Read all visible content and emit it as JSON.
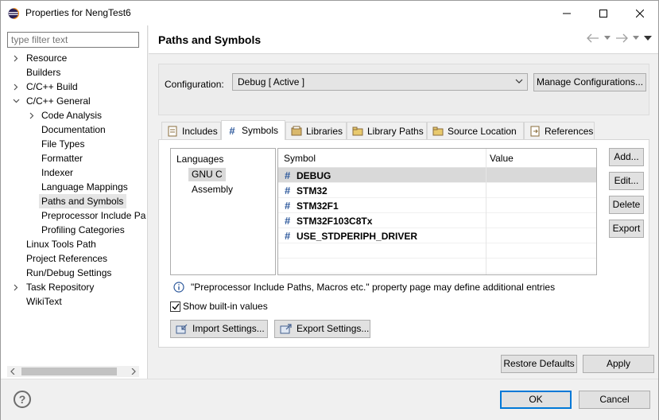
{
  "window": {
    "title": "Properties for NengTest6",
    "minimize_icon": "minimize-icon",
    "maximize_icon": "maximize-icon",
    "close_icon": "close-icon"
  },
  "filter": {
    "placeholder": "type filter text"
  },
  "tree": {
    "items": [
      {
        "label": "Resource",
        "expand": "collapsed"
      },
      {
        "label": "Builders",
        "expand": "none"
      },
      {
        "label": "C/C++ Build",
        "expand": "collapsed"
      },
      {
        "label": "C/C++ General",
        "expand": "expanded"
      },
      {
        "label": "Code Analysis",
        "expand": "collapsed"
      },
      {
        "label": "Documentation",
        "expand": "none"
      },
      {
        "label": "File Types",
        "expand": "none"
      },
      {
        "label": "Formatter",
        "expand": "none"
      },
      {
        "label": "Indexer",
        "expand": "none"
      },
      {
        "label": "Language Mappings",
        "expand": "none"
      },
      {
        "label": "Paths and Symbols",
        "expand": "none",
        "selected": true
      },
      {
        "label": "Preprocessor Include Pa",
        "expand": "none"
      },
      {
        "label": "Profiling Categories",
        "expand": "none"
      },
      {
        "label": "Linux Tools Path",
        "expand": "none"
      },
      {
        "label": "Project References",
        "expand": "none"
      },
      {
        "label": "Run/Debug Settings",
        "expand": "none"
      },
      {
        "label": "Task Repository",
        "expand": "collapsed"
      },
      {
        "label": "WikiText",
        "expand": "none"
      }
    ]
  },
  "page": {
    "title": "Paths and Symbols"
  },
  "configuration": {
    "label": "Configuration:",
    "value": "Debug  [ Active ]",
    "manage_button": "Manage Configurations..."
  },
  "tabs": [
    {
      "label": "Includes",
      "icon": "includes-icon"
    },
    {
      "label": "Symbols",
      "icon": "hash-icon",
      "active": true
    },
    {
      "label": "Libraries",
      "icon": "libraries-icon"
    },
    {
      "label": "Library Paths",
      "icon": "library-paths-icon"
    },
    {
      "label": "Source Location",
      "icon": "source-folder-icon"
    },
    {
      "label": "References",
      "icon": "references-icon"
    }
  ],
  "languages": {
    "header": "Languages",
    "items": [
      {
        "label": "GNU C",
        "selected": true
      },
      {
        "label": "Assembly"
      }
    ]
  },
  "symbols": {
    "columns": [
      "Symbol",
      "Value"
    ],
    "rows": [
      {
        "symbol": "DEBUG",
        "value": "",
        "selected": true
      },
      {
        "symbol": "STM32",
        "value": ""
      },
      {
        "symbol": "STM32F1",
        "value": ""
      },
      {
        "symbol": "STM32F103C8Tx",
        "value": ""
      },
      {
        "symbol": "USE_STDPERIPH_DRIVER",
        "value": ""
      }
    ]
  },
  "side_buttons": {
    "add": "Add...",
    "edit": "Edit...",
    "delete": "Delete",
    "export": "Export"
  },
  "note": "\"Preprocessor Include Paths, Macros etc.\" property page may define additional entries",
  "show_builtin": {
    "label": "Show built-in values",
    "checked": true
  },
  "import_button": "Import Settings...",
  "export_settings_button": "Export Settings...",
  "restore_defaults": "Restore Defaults",
  "apply": "Apply",
  "ok": "OK",
  "cancel": "Cancel",
  "colors": {
    "accent": "#0078d7",
    "hash": "#2f5a9c",
    "selection": "#d9d9d9"
  }
}
